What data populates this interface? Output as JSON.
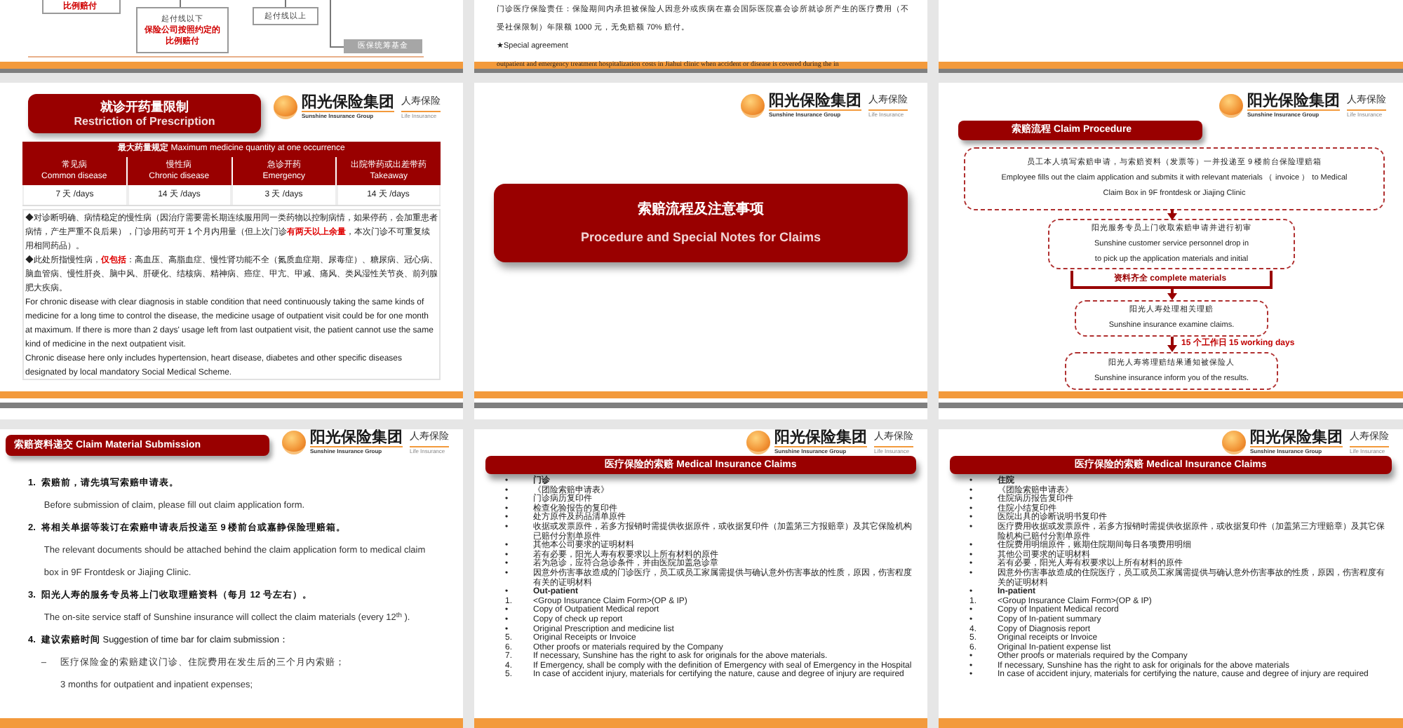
{
  "slides": [
    {
      "kind": "fee_flow",
      "note": "比例赔付",
      "below_box": {
        "label": "起付线以下",
        "lines": [
          "保险公司按照约定的",
          "比例赔付"
        ]
      },
      "above_box": "起付线以上",
      "fund_box": "医保统筹基金"
    },
    {
      "kind": "text_lines",
      "lines": [
        "门诊医疗保险责任：保险期间内承担被保险人因意外或疾病在嘉会国际医院嘉会诊所就诊所产生的医疗费用（不",
        "受社保限制）年限额 1000 元，无免赔额 70% 赔付。",
        "★Special  agreement"
      ],
      "band_line": "outpatient and emergency treatment hospitalization costs in Jiahui clinic when accident or disease is covered during the in"
    },
    {
      "kind": "blank"
    },
    {
      "kind": "prescription",
      "logo": {
        "name": "阳光保险集团",
        "name_en": "Sunshine Insurance Group",
        "division": "人寿保险",
        "division_en": "Life Insurance"
      },
      "title": "就诊开药量限制",
      "subtitle": "Restriction of Prescription",
      "table": {
        "caption": "**最大药量规定** Maximum medicine quantity at one occurrence",
        "columns": [
          "常见病\nCommon disease",
          "慢性病\nChronic disease",
          "急诊开药\nEmergency",
          "出院带药或出差带药\nTakeaway"
        ],
        "values": [
          "7 天 /days",
          "14 天 /days",
          "3 天 /days",
          "14 天 /days"
        ]
      },
      "paragraphs": [
        "◆对诊断明确、病情稳定的慢性病（因治疗需要需长期连续服用同一类药物以控制病情，如果停药，会加重患者病情，产生严重不良后果），门诊用药可开 1 个月内用量（但上次门诊**有两天以上余量**，本次门诊不可重复续用相同药品）。",
        "◆此处所指慢性病，**仅包括**：高血压、高脂血症、慢性肾功能不全（氮质血症期、尿毒症）、糖尿病、冠心病、脑血管病、慢性肝炎、脑中风、肝硬化、结核病、精神病、癌症、甲亢、甲减、痛风、类风湿性关节炎、前列腺肥大疾病。",
        "For chronic disease with clear diagnosis in stable condition that need continuously taking the same kinds of medicine for a long time to control the disease, the medicine usage of outpatient visit could be for one month at maximum. If there is more than 2 days'   usage left from last outpatient visit, the patient cannot use the same kind of medicine in the next outpatient visit.",
        "Chronic disease here only includes hypertension, heart disease, diabetes and other specific diseases designated by local mandatory Social Medical Scheme."
      ]
    },
    {
      "kind": "section_title",
      "logo": {
        "name": "阳光保险集团",
        "name_en": "Sunshine Insurance Group",
        "division": "人寿保险",
        "division_en": "Life Insurance"
      },
      "title": "索赔流程及注意事项",
      "subtitle": "Procedure and Special Notes for Claims"
    },
    {
      "kind": "claim_procedure",
      "logo": {
        "name": "阳光保险集团",
        "name_en": "Sunshine Insurance Group",
        "division": "人寿保险",
        "division_en": "Life Insurance"
      },
      "title": "索赔流程  Claim Procedure",
      "steps": [
        {
          "lines": [
            "员工本人填写索赔申请，与索赔资料（发票等）一并投递至 9 楼前台保险理赔箱",
            "Employee fills out the claim application and submits it with relevant materials  （ invoice ）  to Medical",
            "Claim Box in 9F frontdesk or Jiajing Clinic"
          ]
        },
        {
          "lines": [
            "阳光服务专员上门收取索赔申请并进行初审",
            "Sunshine customer service personnel drop in",
            "to pick up the application materials and initial"
          ]
        },
        {
          "lines": [
            "阳光人寿处理相关理赔",
            "Sunshine insurance examine claims."
          ]
        },
        {
          "lines": [
            "阳光人寿将理赔结果通知被保险人",
            "Sunshine insurance inform you of the results."
          ]
        }
      ],
      "bracket_label": "资料齐全  complete materials",
      "duration": "15 个工作日    15 working days"
    },
    {
      "kind": "submission",
      "logo": {
        "name": "阳光保险集团",
        "name_en": "Sunshine Insurance Group",
        "division": "人寿保险",
        "division_en": "Life Insurance"
      },
      "title": "索赔资料递交  Claim Material Submission",
      "items": [
        {
          "number": "1.",
          "heading": "索赔前，请先填写索赔申请表。",
          "bold": true,
          "detail": "Before submission of claim, please fill out claim application form."
        },
        {
          "number": "2.",
          "heading": "将相关单据等装订在索赔申请表后投递至 9 楼前台或嘉静保险理赔箱。",
          "bold": true,
          "detail": "The relevant documents should be attached behind the claim application form to medical claim box in 9F Frontdesk or Jiajing Clinic."
        },
        {
          "number": "3.",
          "heading": "阳光人寿的服务专员将上门收取理赔资料（每月 12 号左右）。",
          "bold": true,
          "detail": "The on-site service staff of Sunshine insurance  will collect the claim materials (every 12$^{th}$ )."
        },
        {
          "number": "4.",
          "heading": "**建议索赔时间** Suggestion of time bar for claim submission：",
          "bold": false,
          "sub": {
            "marker": "–",
            "text": "医疗保险金的索赔建议门诊、住院费用在发生后的三个月内索赔；",
            "detail": "3 months for outpatient and inpatient expenses;"
          }
        }
      ]
    },
    {
      "kind": "claims_list",
      "logo": {
        "name": "阳光保险集团",
        "name_en": "Sunshine Insurance Group",
        "division": "人寿保险",
        "division_en": "Life Insurance"
      },
      "title": "医疗保险的索赔  Medical Insurance Claims",
      "items": [
        {
          "marker": "•",
          "text": "门诊",
          "bold": true
        },
        {
          "marker": "•",
          "text": "《团险索赔申请表》",
          "bold": false
        },
        {
          "marker": "•",
          "text": "门诊病历复印件",
          "bold": false
        },
        {
          "marker": "•",
          "text": "检查化验报告的复印件",
          "bold": false
        },
        {
          "marker": "•",
          "text": "处方原件及药品清单原件",
          "bold": false
        },
        {
          "marker": "•",
          "text": "收据或发票原件，若多方报销时需提供收据原件，或收据复印件（加盖第三方报赔章）及其它保险机构已赔付分割单原件",
          "bold": false
        },
        {
          "marker": "•",
          "text": "其他本公司要求的证明材料",
          "bold": false
        },
        {
          "marker": "•",
          "text": "若有必要，阳光人寿有权要求以上所有材料的原件",
          "bold": false
        },
        {
          "marker": "•",
          "text": "若为急诊，应符合急诊条件，并由医院加盖急诊章",
          "bold": false
        },
        {
          "marker": "•",
          "text": "因意外伤害事故造成的门诊医疗，员工或员工家属需提供与确认意外伤害事故的性质，原因，伤害程度有关的证明材料",
          "bold": false
        },
        {
          "marker": "•",
          "text": "Out-patient",
          "bold": true
        },
        {
          "marker": "1.",
          "text": "<Group Insurance Claim Form>(OP & IP)",
          "bold": false
        },
        {
          "marker": "•",
          "text": "Copy of Outpatient Medical report",
          "bold": false
        },
        {
          "marker": "•",
          "text": "Copy of check up report",
          "bold": false
        },
        {
          "marker": "•",
          "text": "Original Prescription and medicine list",
          "bold": false
        },
        {
          "marker": "5.",
          "text": "Original Receipts or Invoice",
          "bold": false
        },
        {
          "marker": "6.",
          "text": "Other proofs or materials required by the Company",
          "bold": false
        },
        {
          "marker": "7.",
          "text": "If necessary, Sunshine has the right to ask for originals for the above materials.",
          "bold": false
        },
        {
          "marker": "4.",
          "text": "If Emergency, shall be comply with the definition of Emergency with seal of Emergency in the Hospital",
          "bold": false
        },
        {
          "marker": "5.",
          "text": "In case of accident injury, materials for certifying the nature, cause and degree of injury are required",
          "bold": false
        }
      ]
    },
    {
      "kind": "claims_list",
      "logo": {
        "name": "阳光保险集团",
        "name_en": "Sunshine Insurance Group",
        "division": "人寿保险",
        "division_en": "Life Insurance"
      },
      "title": "医疗保险的索赔  Medical Insurance Claims",
      "items": [
        {
          "marker": "•",
          "text": "住院",
          "bold": true
        },
        {
          "marker": "•",
          "text": "《团险索赔申请表》",
          "bold": false
        },
        {
          "marker": "•",
          "text": "住院病历报告复印件",
          "bold": false
        },
        {
          "marker": "•",
          "text": "住院小结复印件",
          "bold": false
        },
        {
          "marker": "•",
          "text": "医院出具的诊断说明书复印件",
          "bold": false
        },
        {
          "marker": "•",
          "text": "医疗费用收据或发票原件，若多方报销时需提供收据原件，或收据复印件（加盖第三方理赔章）及其它保险机构已赔付分割单原件",
          "bold": false
        },
        {
          "marker": "•",
          "text": "住院费用明细原件，账期住院期间每日各项费用明细",
          "bold": false
        },
        {
          "marker": "•",
          "text": "其他公司要求的证明材料",
          "bold": false
        },
        {
          "marker": "•",
          "text": "若有必要，阳光人寿有权要求以上所有材料的原件",
          "bold": false
        },
        {
          "marker": "•",
          "text": "因意外伤害事故造成的住院医疗，员工或员工家属需提供与确认意外伤害事故的性质，原因，伤害程度有关的证明材料",
          "bold": false
        },
        {
          "marker": "•",
          "text": "In-patient",
          "bold": true
        },
        {
          "marker": "1.",
          "text": "<Group Insurance Claim Form>(OP & IP)",
          "bold": false
        },
        {
          "marker": "•",
          "text": "Copy of Inpatient Medical record",
          "bold": false
        },
        {
          "marker": "•",
          "text": "Copy of In-patient summary",
          "bold": false
        },
        {
          "marker": "4.",
          "text": "Copy of Diagnosis report",
          "bold": false
        },
        {
          "marker": "5.",
          "text": "Original receipts or Invoice",
          "bold": false
        },
        {
          "marker": "6.",
          "text": "Original In-patient expense list",
          "bold": false
        },
        {
          "marker": "•",
          "text": "Other proofs or materials required by the Company",
          "bold": false
        },
        {
          "marker": "•",
          "text": "If necessary, Sunshine  has the right to ask for originals for the above materials",
          "bold": false
        },
        {
          "marker": "•",
          "text": "In case of accident injury, materials for certifying the nature, cause and degree of injury are required",
          "bold": false
        }
      ]
    }
  ]
}
